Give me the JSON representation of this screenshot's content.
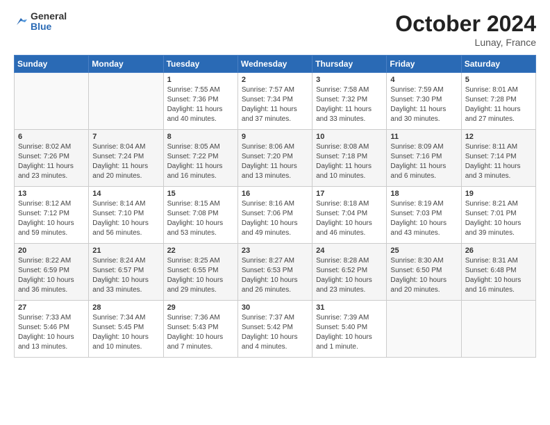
{
  "header": {
    "logo": {
      "general": "General",
      "blue": "Blue"
    },
    "title": "October 2024",
    "location": "Lunay, France"
  },
  "weekdays": [
    "Sunday",
    "Monday",
    "Tuesday",
    "Wednesday",
    "Thursday",
    "Friday",
    "Saturday"
  ],
  "weeks": [
    {
      "days": [
        {
          "num": "",
          "detail": ""
        },
        {
          "num": "",
          "detail": ""
        },
        {
          "num": "1",
          "detail": "Sunrise: 7:55 AM\nSunset: 7:36 PM\nDaylight: 11 hours and 40 minutes."
        },
        {
          "num": "2",
          "detail": "Sunrise: 7:57 AM\nSunset: 7:34 PM\nDaylight: 11 hours and 37 minutes."
        },
        {
          "num": "3",
          "detail": "Sunrise: 7:58 AM\nSunset: 7:32 PM\nDaylight: 11 hours and 33 minutes."
        },
        {
          "num": "4",
          "detail": "Sunrise: 7:59 AM\nSunset: 7:30 PM\nDaylight: 11 hours and 30 minutes."
        },
        {
          "num": "5",
          "detail": "Sunrise: 8:01 AM\nSunset: 7:28 PM\nDaylight: 11 hours and 27 minutes."
        }
      ]
    },
    {
      "days": [
        {
          "num": "6",
          "detail": "Sunrise: 8:02 AM\nSunset: 7:26 PM\nDaylight: 11 hours and 23 minutes."
        },
        {
          "num": "7",
          "detail": "Sunrise: 8:04 AM\nSunset: 7:24 PM\nDaylight: 11 hours and 20 minutes."
        },
        {
          "num": "8",
          "detail": "Sunrise: 8:05 AM\nSunset: 7:22 PM\nDaylight: 11 hours and 16 minutes."
        },
        {
          "num": "9",
          "detail": "Sunrise: 8:06 AM\nSunset: 7:20 PM\nDaylight: 11 hours and 13 minutes."
        },
        {
          "num": "10",
          "detail": "Sunrise: 8:08 AM\nSunset: 7:18 PM\nDaylight: 11 hours and 10 minutes."
        },
        {
          "num": "11",
          "detail": "Sunrise: 8:09 AM\nSunset: 7:16 PM\nDaylight: 11 hours and 6 minutes."
        },
        {
          "num": "12",
          "detail": "Sunrise: 8:11 AM\nSunset: 7:14 PM\nDaylight: 11 hours and 3 minutes."
        }
      ]
    },
    {
      "days": [
        {
          "num": "13",
          "detail": "Sunrise: 8:12 AM\nSunset: 7:12 PM\nDaylight: 10 hours and 59 minutes."
        },
        {
          "num": "14",
          "detail": "Sunrise: 8:14 AM\nSunset: 7:10 PM\nDaylight: 10 hours and 56 minutes."
        },
        {
          "num": "15",
          "detail": "Sunrise: 8:15 AM\nSunset: 7:08 PM\nDaylight: 10 hours and 53 minutes."
        },
        {
          "num": "16",
          "detail": "Sunrise: 8:16 AM\nSunset: 7:06 PM\nDaylight: 10 hours and 49 minutes."
        },
        {
          "num": "17",
          "detail": "Sunrise: 8:18 AM\nSunset: 7:04 PM\nDaylight: 10 hours and 46 minutes."
        },
        {
          "num": "18",
          "detail": "Sunrise: 8:19 AM\nSunset: 7:03 PM\nDaylight: 10 hours and 43 minutes."
        },
        {
          "num": "19",
          "detail": "Sunrise: 8:21 AM\nSunset: 7:01 PM\nDaylight: 10 hours and 39 minutes."
        }
      ]
    },
    {
      "days": [
        {
          "num": "20",
          "detail": "Sunrise: 8:22 AM\nSunset: 6:59 PM\nDaylight: 10 hours and 36 minutes."
        },
        {
          "num": "21",
          "detail": "Sunrise: 8:24 AM\nSunset: 6:57 PM\nDaylight: 10 hours and 33 minutes."
        },
        {
          "num": "22",
          "detail": "Sunrise: 8:25 AM\nSunset: 6:55 PM\nDaylight: 10 hours and 29 minutes."
        },
        {
          "num": "23",
          "detail": "Sunrise: 8:27 AM\nSunset: 6:53 PM\nDaylight: 10 hours and 26 minutes."
        },
        {
          "num": "24",
          "detail": "Sunrise: 8:28 AM\nSunset: 6:52 PM\nDaylight: 10 hours and 23 minutes."
        },
        {
          "num": "25",
          "detail": "Sunrise: 8:30 AM\nSunset: 6:50 PM\nDaylight: 10 hours and 20 minutes."
        },
        {
          "num": "26",
          "detail": "Sunrise: 8:31 AM\nSunset: 6:48 PM\nDaylight: 10 hours and 16 minutes."
        }
      ]
    },
    {
      "days": [
        {
          "num": "27",
          "detail": "Sunrise: 7:33 AM\nSunset: 5:46 PM\nDaylight: 10 hours and 13 minutes."
        },
        {
          "num": "28",
          "detail": "Sunrise: 7:34 AM\nSunset: 5:45 PM\nDaylight: 10 hours and 10 minutes."
        },
        {
          "num": "29",
          "detail": "Sunrise: 7:36 AM\nSunset: 5:43 PM\nDaylight: 10 hours and 7 minutes."
        },
        {
          "num": "30",
          "detail": "Sunrise: 7:37 AM\nSunset: 5:42 PM\nDaylight: 10 hours and 4 minutes."
        },
        {
          "num": "31",
          "detail": "Sunrise: 7:39 AM\nSunset: 5:40 PM\nDaylight: 10 hours and 1 minute."
        },
        {
          "num": "",
          "detail": ""
        },
        {
          "num": "",
          "detail": ""
        }
      ]
    }
  ]
}
